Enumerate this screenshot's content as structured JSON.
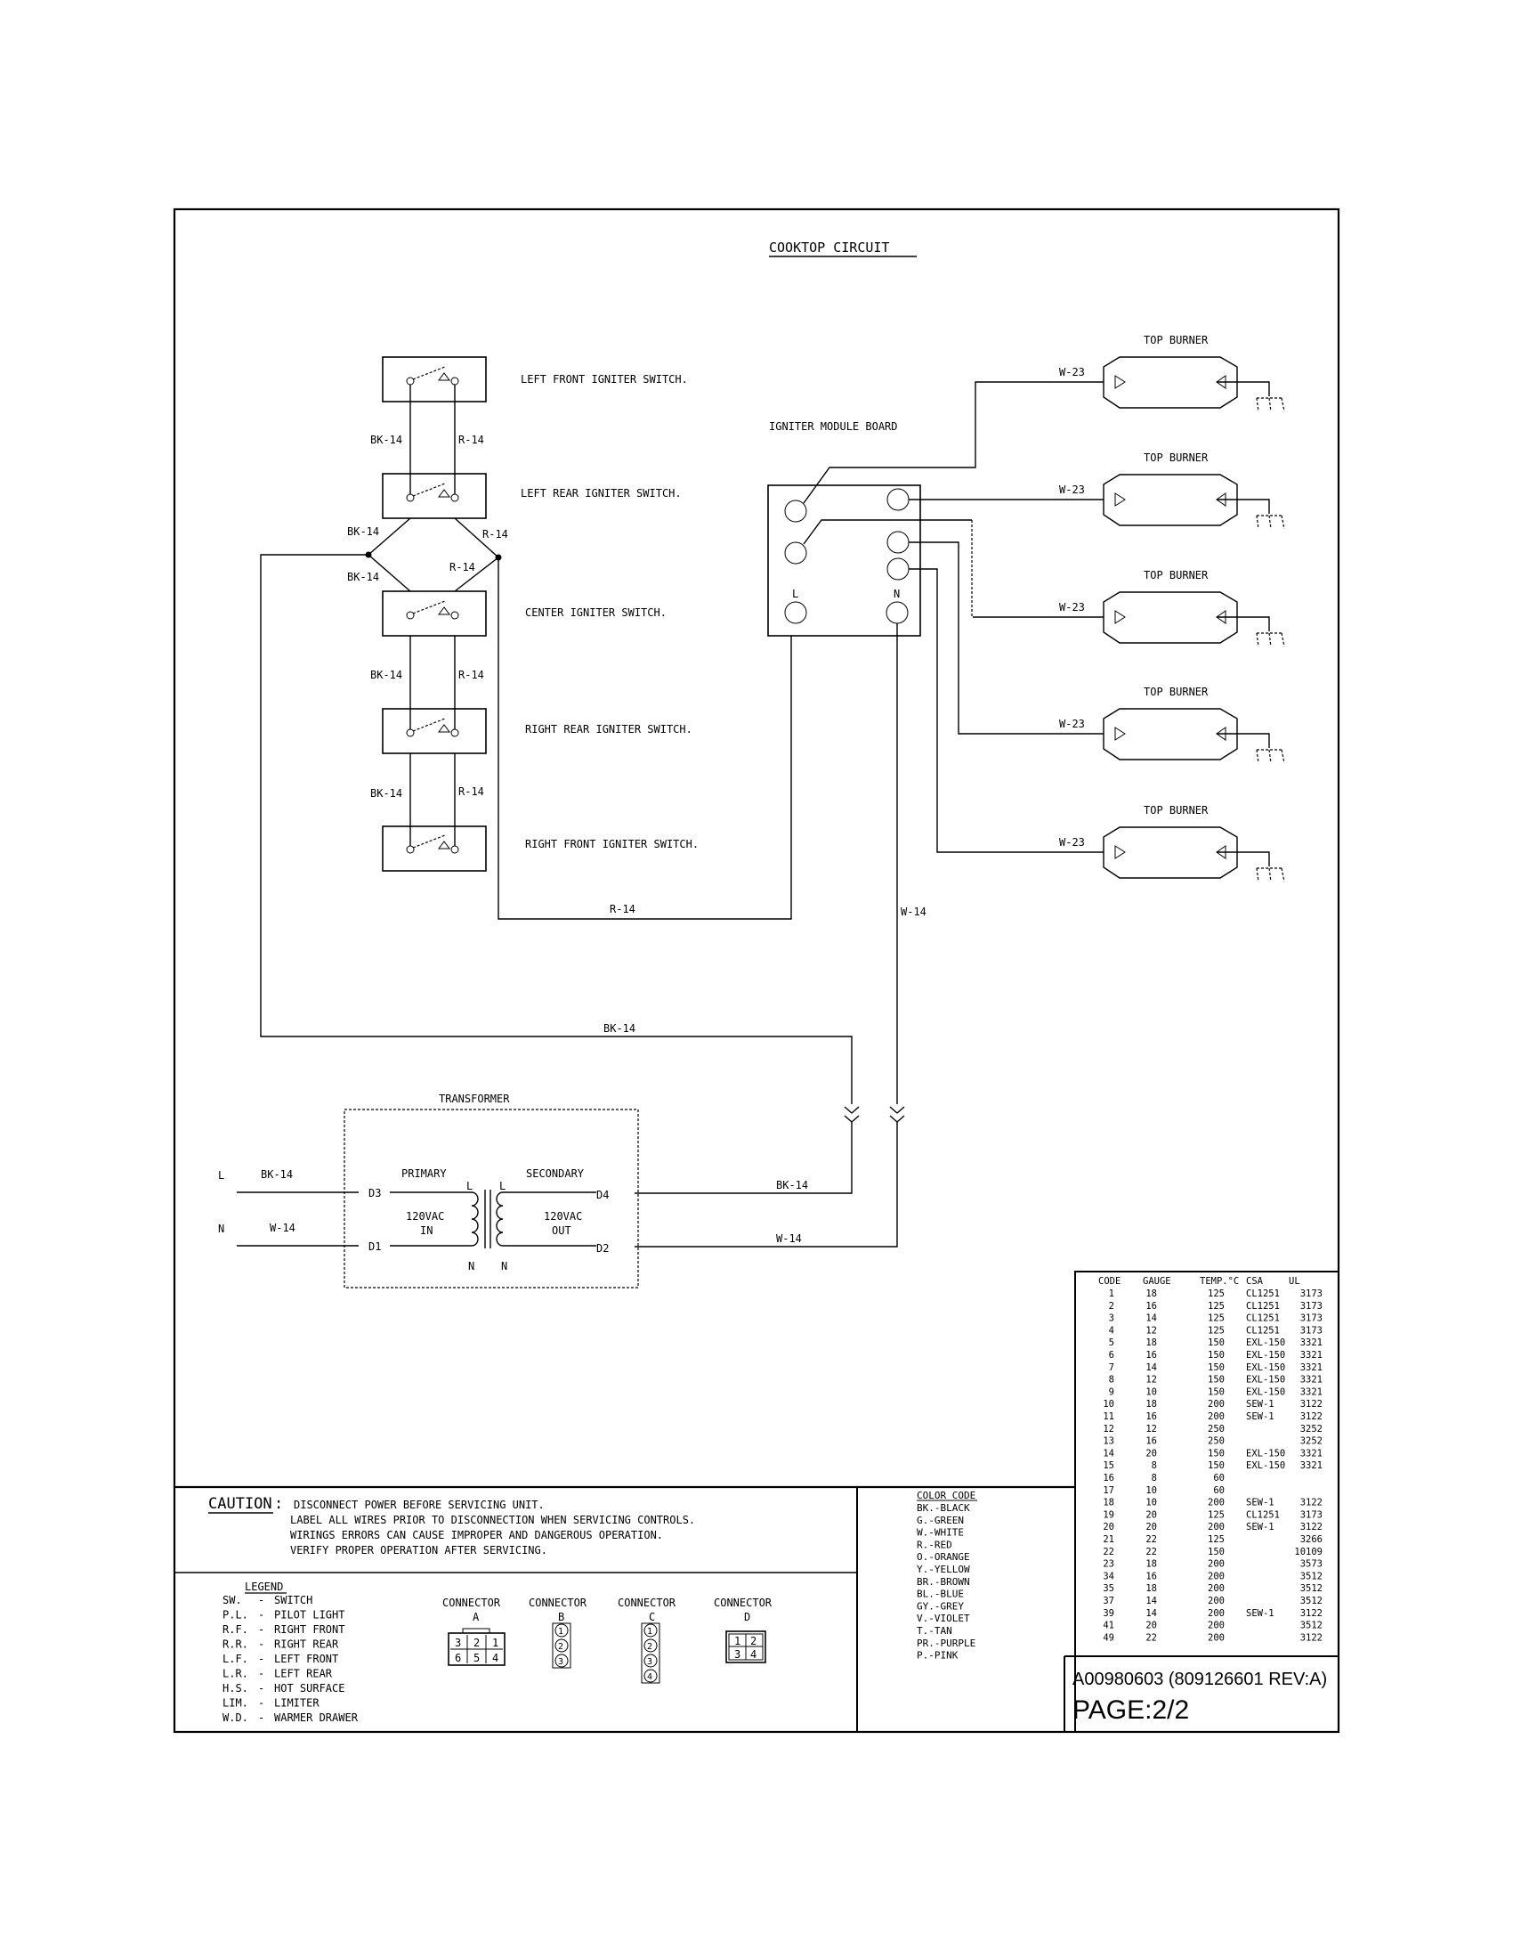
{
  "title": "COOKTOP CIRCUIT",
  "switches": [
    {
      "label": "LEFT FRONT IGNITER SWITCH."
    },
    {
      "label": "LEFT REAR IGNITER SWITCH."
    },
    {
      "label": "CENTER IGNITER SWITCH."
    },
    {
      "label": "RIGHT REAR IGNITER SWITCH."
    },
    {
      "label": "RIGHT FRONT IGNITER SWITCH."
    }
  ],
  "wires": {
    "bk14": "BK-14",
    "r14": "R-14",
    "w14": "W-14",
    "w23": "W-23"
  },
  "module": {
    "label": "IGNITER MODULE BOARD",
    "l": "L",
    "n": "N"
  },
  "burners": [
    {
      "label": "TOP BURNER",
      "wire": "W-23"
    },
    {
      "label": "TOP BURNER",
      "wire": "W-23"
    },
    {
      "label": "TOP BURNER",
      "wire": "W-23"
    },
    {
      "label": "TOP BURNER",
      "wire": "W-23"
    },
    {
      "label": "TOP BURNER",
      "wire": "W-23"
    }
  ],
  "transformer": {
    "label": "TRANSFORMER",
    "primary": "PRIMARY",
    "secondary": "SECONDARY",
    "in_v": "120VAC",
    "in": "IN",
    "out_v": "120VAC",
    "out": "OUT",
    "d1": "D1",
    "d2": "D2",
    "d3": "D3",
    "d4": "D4",
    "l": "L",
    "n": "N",
    "line_l": "L",
    "line_n": "N"
  },
  "caution": {
    "heading": "CAUTION",
    "lines": [
      "DISCONNECT POWER BEFORE SERVICING UNIT.",
      "LABEL ALL WIRES PRIOR TO DISCONNECTION WHEN SERVICING CONTROLS.",
      "WIRINGS ERRORS CAN CAUSE IMPROPER AND DANGEROUS OPERATION.",
      "VERIFY PROPER OPERATION AFTER SERVICING."
    ]
  },
  "legend": {
    "heading": "LEGEND",
    "items": [
      {
        "abbr": "SW.",
        "text": "SWITCH"
      },
      {
        "abbr": "P.L.",
        "text": "PILOT LIGHT"
      },
      {
        "abbr": "R.F.",
        "text": "RIGHT FRONT"
      },
      {
        "abbr": "R.R.",
        "text": "RIGHT REAR"
      },
      {
        "abbr": "L.F.",
        "text": "LEFT FRONT"
      },
      {
        "abbr": "L.R.",
        "text": "LEFT REAR"
      },
      {
        "abbr": "H.S.",
        "text": "HOT SURFACE"
      },
      {
        "abbr": "LIM.",
        "text": "LIMITER"
      },
      {
        "abbr": "W.D.",
        "text": "WARMER DRAWER"
      }
    ]
  },
  "connectors": [
    {
      "label": "CONNECTOR",
      "id": "A",
      "pins": [
        "3",
        "2",
        "1",
        "6",
        "5",
        "4"
      ]
    },
    {
      "label": "CONNECTOR",
      "id": "B",
      "pins": [
        "1",
        "2",
        "3"
      ]
    },
    {
      "label": "CONNECTOR",
      "id": "C",
      "pins": [
        "1",
        "2",
        "3",
        "4"
      ]
    },
    {
      "label": "CONNECTOR",
      "id": "D",
      "pins": [
        "1",
        "2",
        "3",
        "4"
      ]
    }
  ],
  "color_code": {
    "heading": "COLOR CODE",
    "items": [
      "BK.-BLACK",
      "G.-GREEN",
      "W.-WHITE",
      "R.-RED",
      "O.-ORANGE",
      "Y.-YELLOW",
      "BR.-BROWN",
      "BL.-BLUE",
      "GY.-GREY",
      "V.-VIOLET",
      "T.-TAN",
      "PR.-PURPLE",
      "P.-PINK"
    ]
  },
  "wire_table": {
    "headers": [
      "CODE",
      "GAUGE",
      "TEMP.°C",
      "CSA",
      "UL"
    ],
    "rows": [
      [
        "1",
        "18",
        "125",
        "CL1251",
        "3173"
      ],
      [
        "2",
        "16",
        "125",
        "CL1251",
        "3173"
      ],
      [
        "3",
        "14",
        "125",
        "CL1251",
        "3173"
      ],
      [
        "4",
        "12",
        "125",
        "CL1251",
        "3173"
      ],
      [
        "5",
        "18",
        "150",
        "EXL-150",
        "3321"
      ],
      [
        "6",
        "16",
        "150",
        "EXL-150",
        "3321"
      ],
      [
        "7",
        "14",
        "150",
        "EXL-150",
        "3321"
      ],
      [
        "8",
        "12",
        "150",
        "EXL-150",
        "3321"
      ],
      [
        "9",
        "10",
        "150",
        "EXL-150",
        "3321"
      ],
      [
        "10",
        "18",
        "200",
        "SEW-1",
        "3122"
      ],
      [
        "11",
        "16",
        "200",
        "SEW-1",
        "3122"
      ],
      [
        "12",
        "12",
        "250",
        "",
        "3252"
      ],
      [
        "13",
        "16",
        "250",
        "",
        "3252"
      ],
      [
        "14",
        "20",
        "150",
        "EXL-150",
        "3321"
      ],
      [
        "15",
        "8",
        "150",
        "EXL-150",
        "3321"
      ],
      [
        "16",
        "8",
        "60",
        "",
        ""
      ],
      [
        "17",
        "10",
        "60",
        "",
        ""
      ],
      [
        "18",
        "10",
        "200",
        "SEW-1",
        "3122"
      ],
      [
        "19",
        "20",
        "125",
        "CL1251",
        "3173"
      ],
      [
        "20",
        "20",
        "200",
        "SEW-1",
        "3122"
      ],
      [
        "21",
        "22",
        "125",
        "",
        "3266"
      ],
      [
        "22",
        "22",
        "150",
        "",
        "10109"
      ],
      [
        "23",
        "18",
        "200",
        "",
        "3573"
      ],
      [
        "34",
        "16",
        "200",
        "",
        "3512"
      ],
      [
        "35",
        "18",
        "200",
        "",
        "3512"
      ],
      [
        "37",
        "14",
        "200",
        "",
        "3512"
      ],
      [
        "39",
        "14",
        "200",
        "SEW-1",
        "3122"
      ],
      [
        "41",
        "20",
        "200",
        "",
        "3512"
      ],
      [
        "49",
        "22",
        "200",
        "",
        "3122"
      ]
    ]
  },
  "doc_number": "A00980603 (809126601 REV:A)",
  "page": "PAGE:2/2"
}
